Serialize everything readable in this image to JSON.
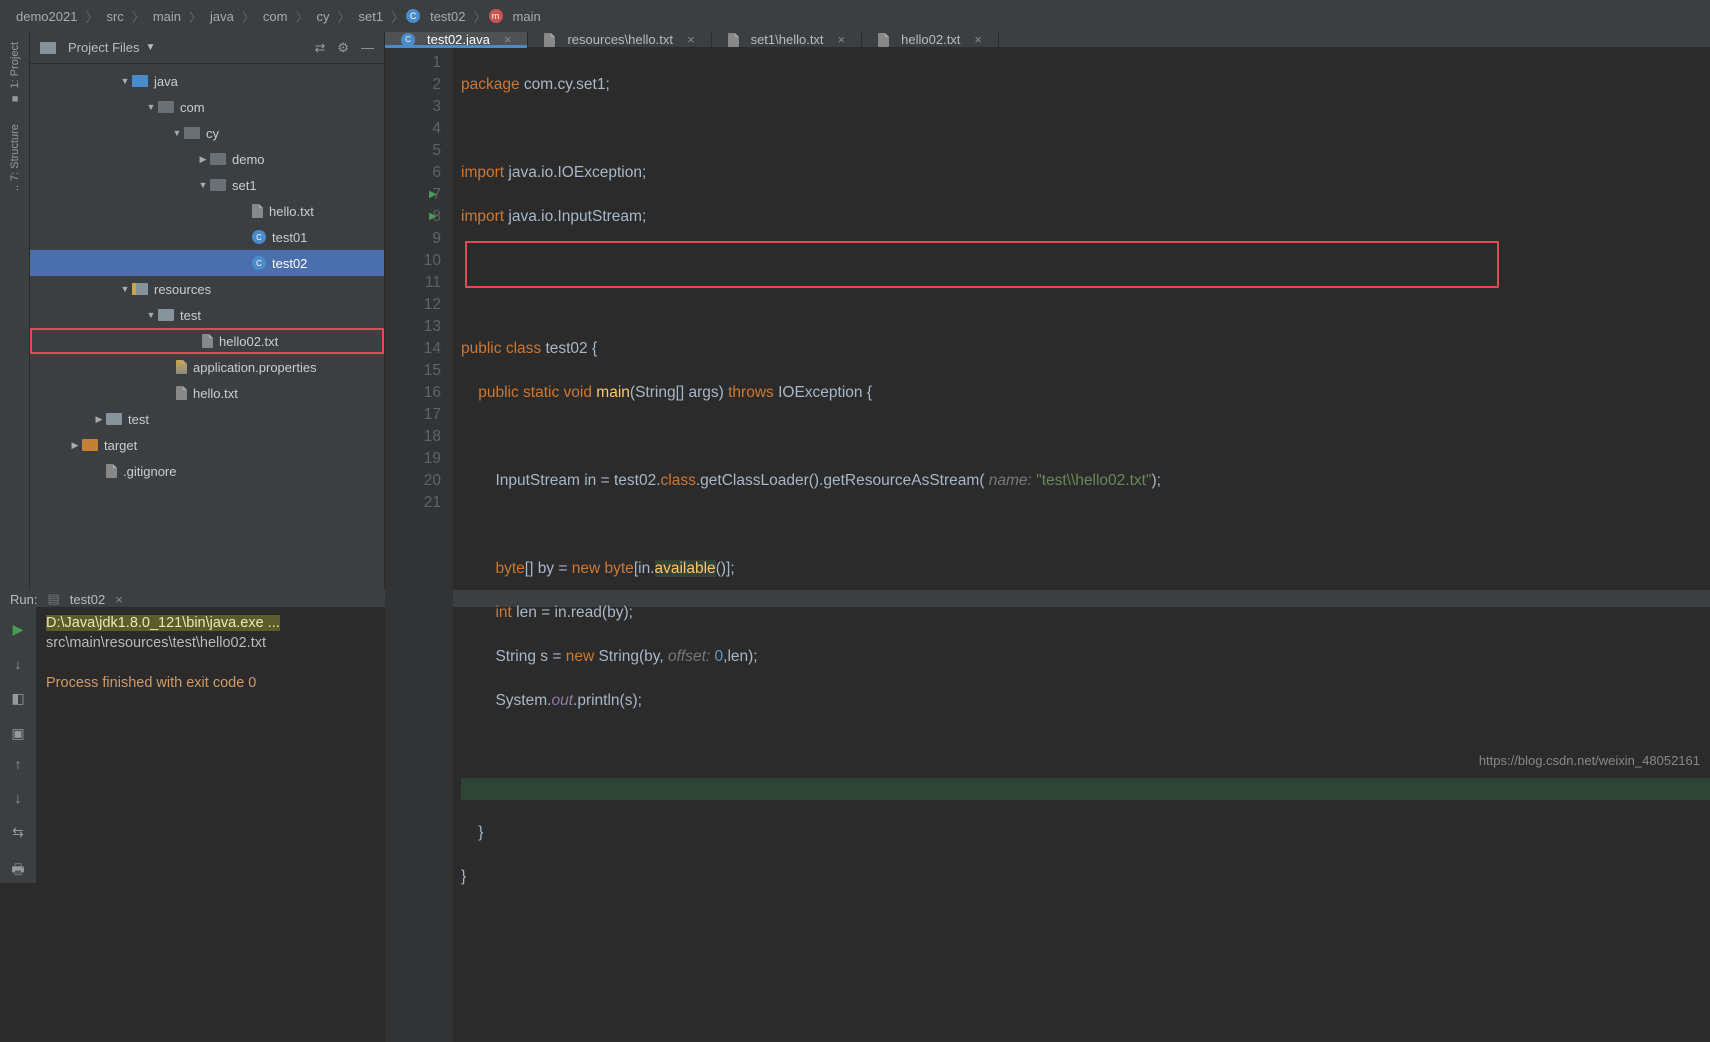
{
  "breadcrumbs": [
    "demo2021",
    "src",
    "main",
    "java",
    "com",
    "cy",
    "set1",
    "test02",
    "main"
  ],
  "sidebar": {
    "project_label": "1: Project",
    "structure_label": "7: Structure"
  },
  "project": {
    "header": "Project Files",
    "tree": [
      {
        "indent": 80,
        "arrow": "▼",
        "icon": "folder-blue",
        "label": "java"
      },
      {
        "indent": 106,
        "arrow": "▼",
        "icon": "folder-dark",
        "label": "com"
      },
      {
        "indent": 132,
        "arrow": "▼",
        "icon": "folder-dark",
        "label": "cy"
      },
      {
        "indent": 158,
        "arrow": "▶",
        "icon": "folder-dark",
        "label": "demo"
      },
      {
        "indent": 158,
        "arrow": "▼",
        "icon": "folder-dark",
        "label": "set1"
      },
      {
        "indent": 200,
        "arrow": "",
        "icon": "file",
        "label": "hello.txt"
      },
      {
        "indent": 200,
        "arrow": "",
        "icon": "class",
        "label": "test01"
      },
      {
        "indent": 200,
        "arrow": "",
        "icon": "class",
        "label": "test02",
        "selected": true
      },
      {
        "indent": 80,
        "arrow": "▼",
        "icon": "folder-resroot",
        "label": "resources"
      },
      {
        "indent": 106,
        "arrow": "▼",
        "icon": "folder",
        "label": "test"
      },
      {
        "indent": 148,
        "arrow": "",
        "icon": "file",
        "label": "hello02.txt",
        "boxed": true
      },
      {
        "indent": 124,
        "arrow": "",
        "icon": "file-res",
        "label": "application.properties"
      },
      {
        "indent": 124,
        "arrow": "",
        "icon": "file",
        "label": "hello.txt"
      },
      {
        "indent": 54,
        "arrow": "▶",
        "icon": "folder",
        "label": "test"
      },
      {
        "indent": 30,
        "arrow": "▶",
        "icon": "folder-orange",
        "label": "target"
      },
      {
        "indent": 54,
        "arrow": "",
        "icon": "file",
        "label": ".gitignore"
      }
    ]
  },
  "tabs": [
    {
      "icon": "class",
      "label": "test02.java",
      "active": true
    },
    {
      "icon": "file",
      "label": "resources\\hello.txt"
    },
    {
      "icon": "file",
      "label": "set1\\hello.txt"
    },
    {
      "icon": "file",
      "label": "hello02.txt"
    }
  ],
  "code": {
    "package_kw": "package",
    "package_path": "com.cy.set1",
    "import_kw": "import",
    "import1": "java.io.IOException",
    "import2": "java.io.InputStream",
    "public_kw": "public",
    "class_kw": "class",
    "class_name": "test02",
    "static_kw": "static",
    "void_kw": "void",
    "main_name": "main",
    "string_arr": "String[] args",
    "throws_kw": "throws",
    "exc": "IOException",
    "line10_type": "InputStream",
    "line10_var": "in",
    "line10_target": "test02",
    "line10_class_kw": "class",
    "line10_m1": "getClassLoader",
    "line10_m2": "getResourceAsStream",
    "line10_hint": "name:",
    "line10_str": "\"test\\\\hello02.txt\"",
    "byte_kw": "byte",
    "new_kw": "new",
    "available_m": "available",
    "int_kw": "int",
    "len_var": "len",
    "read_m": "read",
    "by_var": "by",
    "string_cls": "String",
    "s_var": "s",
    "offset_hint": "offset:",
    "zero": "0",
    "system_cls": "System",
    "out_field": "out",
    "println_m": "println"
  },
  "run": {
    "label": "Run:",
    "tab": "test02",
    "cmd": "D:\\Java\\jdk1.8.0_121\\bin\\java.exe ...",
    "output": "src\\main\\resources\\test\\hello02.txt",
    "exit": "Process finished with exit code 0"
  },
  "watermark": "https://blog.csdn.net/weixin_48052161"
}
